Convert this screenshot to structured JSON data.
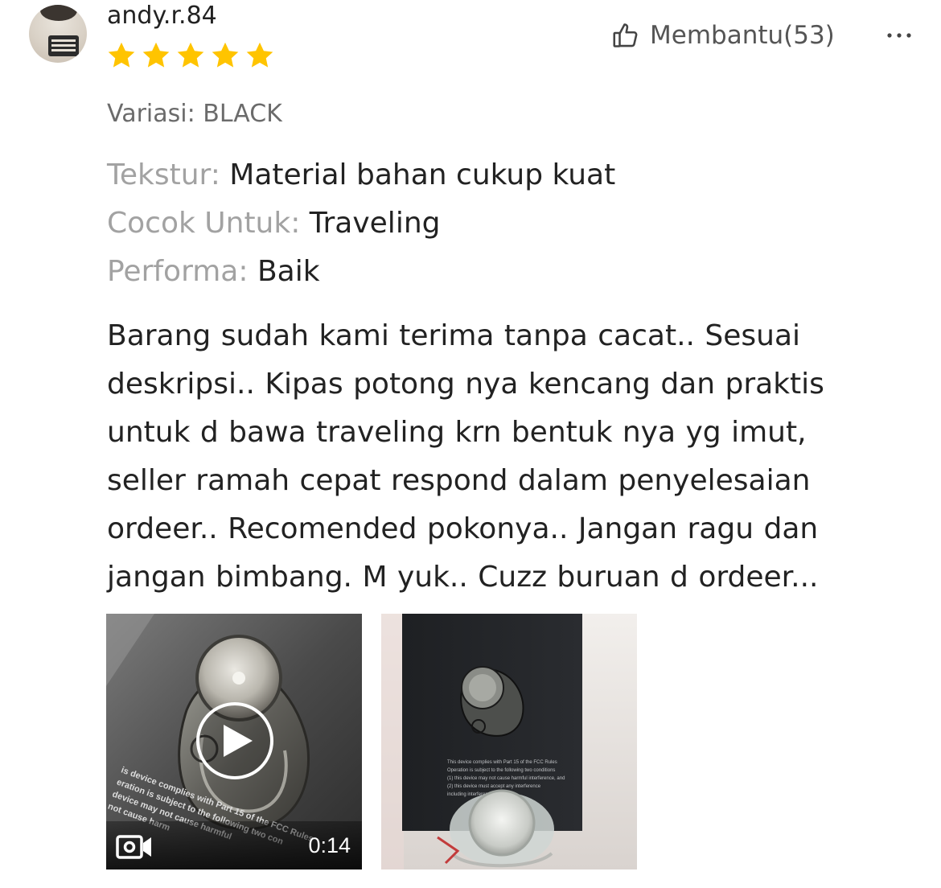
{
  "review": {
    "username": "andy.r.84",
    "rating": 5,
    "helpful_label": "Membantu(53)",
    "variation": "Variasi: BLACK",
    "attributes": [
      {
        "key": "Tekstur: ",
        "value": "Material bahan cukup kuat"
      },
      {
        "key": "Cocok Untuk: ",
        "value": "Traveling"
      },
      {
        "key": "Performa: ",
        "value": "Baik"
      }
    ],
    "comment_lines": [
      "Barang sudah kami terima tanpa cacat.. Sesuai",
      "deskripsi.. Kipas potong nya kencang dan praktis",
      "untuk d bawa traveling krn bentuk nya yg imut,",
      "seller ramah cepat respond dalam penyelesaian",
      "ordeer.. Recomended pokonya.. Jangan ragu dan",
      "jangan bimbang. M yuk.. Cuzz buruan d ordeer..."
    ],
    "media": [
      {
        "type": "video",
        "duration": "0:14"
      },
      {
        "type": "image"
      }
    ]
  },
  "colors": {
    "star": "#FFC400",
    "text_primary": "#222222",
    "text_secondary": "#A2A2A2",
    "helpful_text": "#555555"
  },
  "icons": {
    "helpful": "thumbs-up-icon",
    "more": "more-dots-icon",
    "play": "play-icon",
    "video": "video-camera-icon",
    "star": "star-icon"
  }
}
